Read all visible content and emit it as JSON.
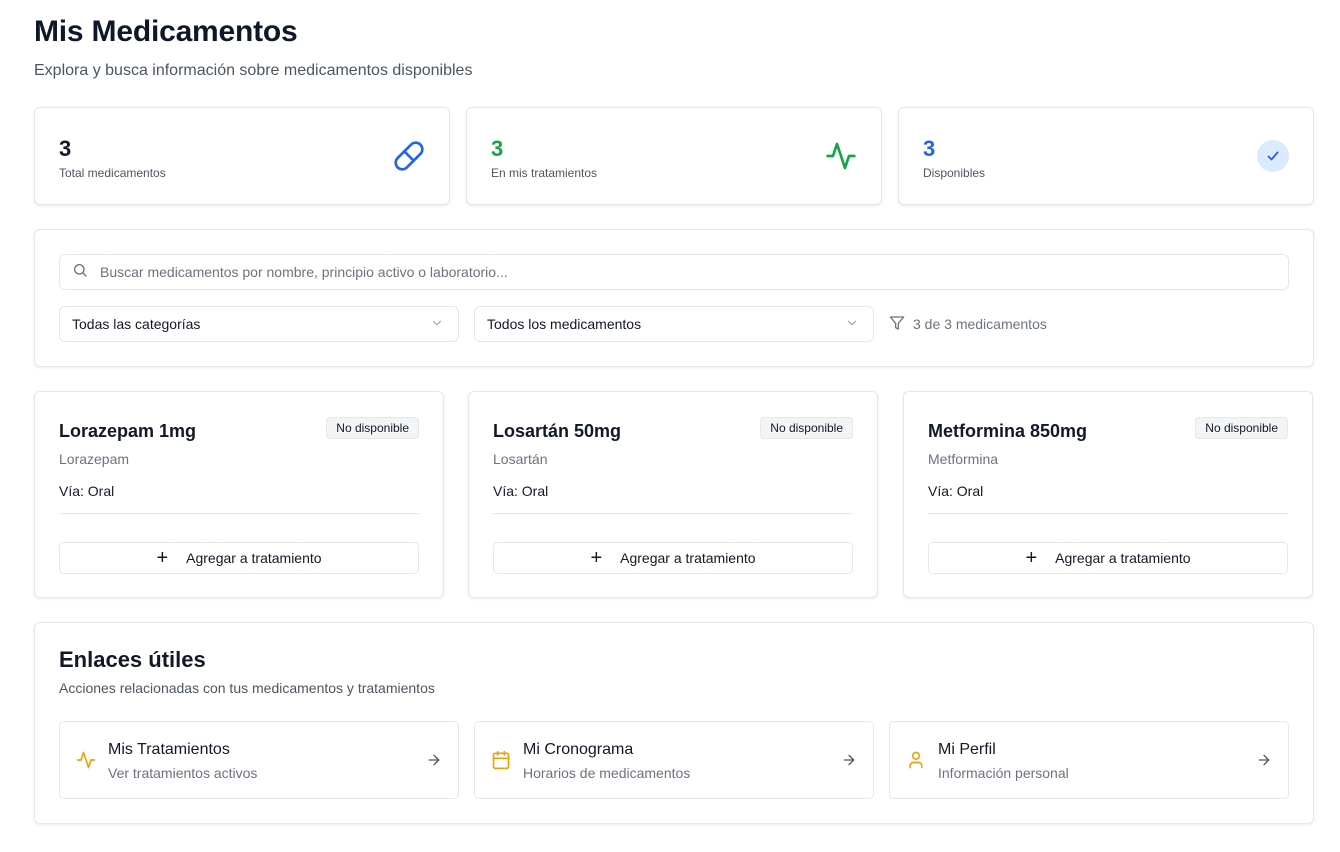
{
  "header": {
    "title": "Mis Medicamentos",
    "subtitle": "Explora y busca información sobre medicamentos disponibles"
  },
  "stats": [
    {
      "value": "3",
      "label": "Total medicamentos",
      "color": "#111827",
      "icon": "pill-icon",
      "icon_color": "#2563eb"
    },
    {
      "value": "3",
      "label": "En mis tratamientos",
      "color": "#16a34a",
      "icon": "activity-icon",
      "icon_color": "#16a34a"
    },
    {
      "value": "3",
      "label": "Disponibles",
      "color": "#2563eb",
      "icon": "check-circle-icon",
      "icon_color": "#2563eb"
    }
  ],
  "filters": {
    "search_placeholder": "Buscar medicamentos por nombre, principio activo o laboratorio...",
    "category_selected": "Todas las categorías",
    "medication_selected": "Todos los medicamentos",
    "result_count": "3 de 3 medicamentos"
  },
  "medications": [
    {
      "name": "Lorazepam 1mg",
      "generic": "Lorazepam",
      "route": "Vía: Oral",
      "badge": "No disponible",
      "action": "Agregar a tratamiento"
    },
    {
      "name": "Losartán 50mg",
      "generic": "Losartán",
      "route": "Vía: Oral",
      "badge": "No disponible",
      "action": "Agregar a tratamiento"
    },
    {
      "name": "Metformina 850mg",
      "generic": "Metformina",
      "route": "Vía: Oral",
      "badge": "No disponible",
      "action": "Agregar a tratamiento"
    }
  ],
  "links": {
    "title": "Enlaces útiles",
    "subtitle": "Acciones relacionadas con tus medicamentos y tratamientos",
    "items": [
      {
        "title": "Mis Tratamientos",
        "desc": "Ver tratamientos activos",
        "icon": "activity-icon"
      },
      {
        "title": "Mi Cronograma",
        "desc": "Horarios de medicamentos",
        "icon": "calendar-icon"
      },
      {
        "title": "Mi Perfil",
        "desc": "Información personal",
        "icon": "user-icon"
      }
    ],
    "icon_color": "#f59e0b"
  }
}
